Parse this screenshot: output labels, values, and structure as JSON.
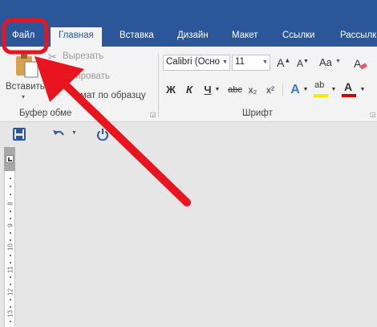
{
  "tabs": [
    {
      "label": "Файл",
      "active": false
    },
    {
      "label": "Главная",
      "active": true
    },
    {
      "label": "Вставка",
      "active": false
    },
    {
      "label": "Дизайн",
      "active": false
    },
    {
      "label": "Макет",
      "active": false
    },
    {
      "label": "Ссылки",
      "active": false
    },
    {
      "label": "Рассылк",
      "active": false
    }
  ],
  "clipboard": {
    "paste_label": "Вставить",
    "cut_label": "Вырезать",
    "copy_label": "пировать",
    "format_painter_label": "мат по образцу",
    "group_label": "Буфер обме"
  },
  "font": {
    "font_name": "Calibri (Осно",
    "font_size": "11",
    "bold_label": "Ж",
    "italic_label": "К",
    "underline_label": "Ч",
    "strike_label": "abc",
    "subscript_label": "x₂",
    "superscript_label": "x²",
    "case_label": "Aa",
    "highlight_label": "ab",
    "font_color_label": "A",
    "group_label": "Шрифт"
  },
  "ruler_numbers": [
    "8",
    "9",
    "10",
    "11",
    "12",
    "13"
  ],
  "colors": {
    "ribbon_blue": "#2b579a",
    "annotation_red": "#e8141e",
    "highlight_yellow": "#ffe800",
    "font_color_red": "#d40000"
  },
  "icons": [
    "save-icon",
    "undo-icon",
    "power-icon",
    "scissors-icon",
    "paste-icon",
    "format-painter-icon"
  ]
}
